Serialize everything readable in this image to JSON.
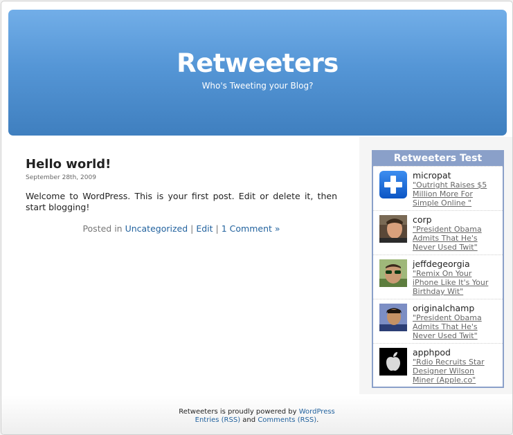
{
  "blog": {
    "title": "Retweeters",
    "description": "Who's Tweeting your Blog?"
  },
  "post": {
    "title": "Hello world!",
    "date": "September 28th, 2009",
    "body": "Welcome to WordPress. This is your first post. Edit or delete it, then start blogging!",
    "posted_in_label": "Posted in",
    "category": "Uncategorized",
    "separator": "|",
    "edit": "Edit",
    "comments": "1 Comment »"
  },
  "widget": {
    "title": "Retweeters Test",
    "tweets": [
      {
        "user": "micropat",
        "text": "\"Outright Raises $5 Million More For Simple Online \"",
        "avatar": "blue-plus-icon"
      },
      {
        "user": "corp",
        "text": "\"President Obama Admits That He's Never Used Twit\"",
        "avatar": "person-photo"
      },
      {
        "user": "jeffdegeorgia",
        "text": "\"Remix On Your iPhone Like It's Your Birthday Wit\"",
        "avatar": "person-sunglasses-photo"
      },
      {
        "user": "originalchamp",
        "text": "\"President Obama Admits That He's Never Used Twit\"",
        "avatar": "person-photo"
      },
      {
        "user": "apphpod",
        "text": "\"Rdio Recruits Star Designer Wilson Miner (Apple.co\"",
        "avatar": "apple-logo-icon"
      }
    ]
  },
  "footer": {
    "powered_prefix": "Retweeters is proudly powered by",
    "wordpress": "WordPress",
    "entries_rss": "Entries (RSS)",
    "and": "and",
    "comments_rss": "Comments (RSS)",
    "period": "."
  }
}
